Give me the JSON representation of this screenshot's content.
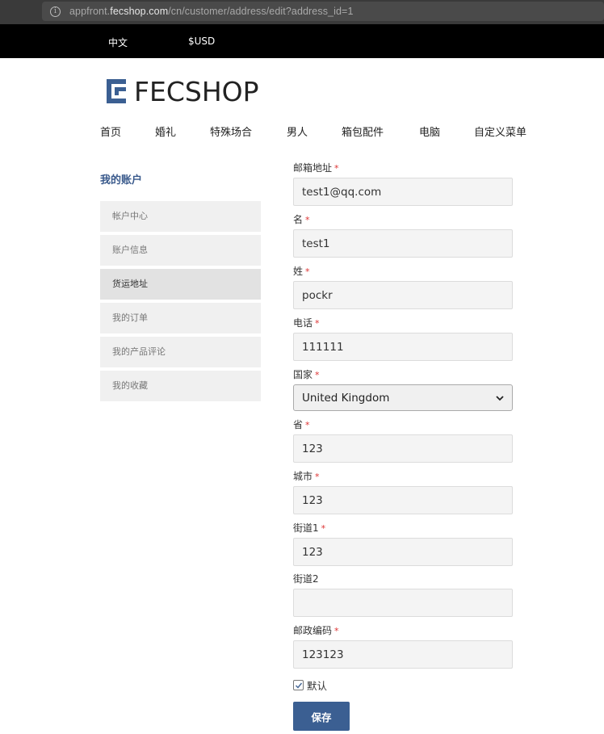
{
  "browser": {
    "url_prefix": "appfront.",
    "url_host": "fecshop.com",
    "url_path": "/cn/customer/address/edit?address_id=1"
  },
  "topbar": {
    "language": "中文",
    "currency": "$USD"
  },
  "logo": {
    "text": "FECSHOP"
  },
  "nav": {
    "items": [
      "首页",
      "婚礼",
      "特殊场合",
      "男人",
      "箱包配件",
      "电脑",
      "自定义菜单"
    ]
  },
  "sidebar": {
    "title": "我的账户",
    "items": [
      {
        "label": "帐户中心"
      },
      {
        "label": "账户信息"
      },
      {
        "label": "货运地址",
        "active": true
      },
      {
        "label": "我的订单"
      },
      {
        "label": "我的产品评论"
      },
      {
        "label": "我的收藏"
      }
    ]
  },
  "form": {
    "email": {
      "label": "邮箱地址",
      "value": "test1@qq.com",
      "required": true
    },
    "first_name": {
      "label": "名",
      "value": "test1",
      "required": true
    },
    "last_name": {
      "label": "姓",
      "value": "pockr",
      "required": true
    },
    "phone": {
      "label": "电话",
      "value": "111111",
      "required": true
    },
    "country": {
      "label": "国家",
      "value": "United Kingdom",
      "required": true
    },
    "state": {
      "label": "省",
      "value": "123",
      "required": true
    },
    "city": {
      "label": "城市",
      "value": "123",
      "required": true
    },
    "street1": {
      "label": "街道1",
      "value": "123",
      "required": true
    },
    "street2": {
      "label": "街道2",
      "value": "",
      "required": false
    },
    "zip": {
      "label": "邮政编码",
      "value": "123123",
      "required": true
    },
    "required_mark": "*",
    "default_label": "默认",
    "default_checked": true,
    "save_label": "保存"
  },
  "colors": {
    "accent": "#3b5f92",
    "sidebar_title": "#3a5a8c",
    "required": "#dd3333",
    "topbar": "#000000"
  }
}
